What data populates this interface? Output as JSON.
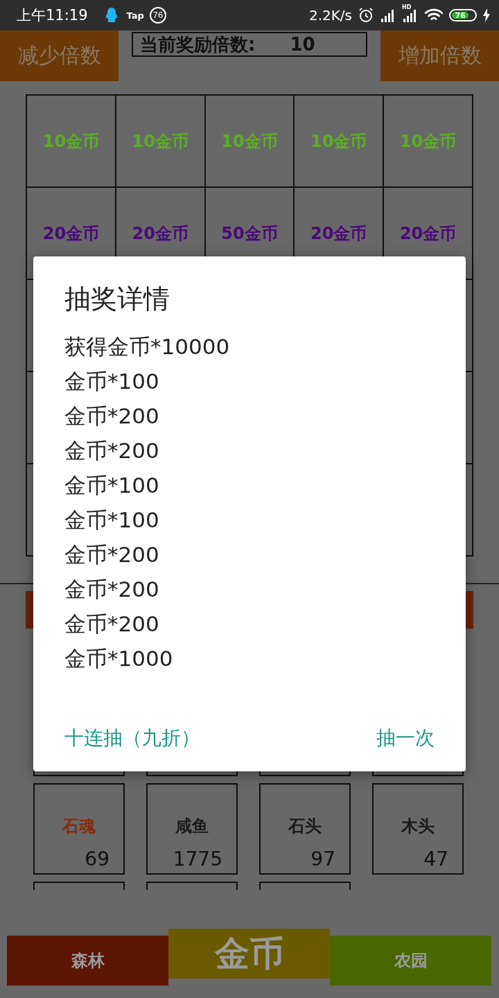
{
  "status_bar": {
    "time": "上午11:19",
    "app_label": "Tap",
    "notification_count": "76",
    "net_speed": "2.2K/s",
    "signal_tag": "HD",
    "battery": "76"
  },
  "header": {
    "decrease_button": "减少倍数",
    "multiplier_label": "当前奖励倍数:",
    "multiplier_value": "10",
    "increase_button": "增加倍数"
  },
  "prize_grid": {
    "rows": [
      {
        "cells": [
          {
            "label": "10金币",
            "color": "#5aae22"
          },
          {
            "label": "10金币",
            "color": "#5aae22"
          },
          {
            "label": "10金币",
            "color": "#5aae22"
          },
          {
            "label": "10金币",
            "color": "#5aae22"
          },
          {
            "label": "10金币",
            "color": "#5aae22"
          }
        ]
      },
      {
        "cells": [
          {
            "label": "20金币",
            "color": "#4a0a78"
          },
          {
            "label": "20金币",
            "color": "#4a0a78"
          },
          {
            "label": "50金币",
            "color": "#4a0a78"
          },
          {
            "label": "20金币",
            "color": "#4a0a78"
          },
          {
            "label": "20金币",
            "color": "#4a0a78"
          }
        ]
      }
    ]
  },
  "inventory": [
    {
      "name": "石魂",
      "count": "69",
      "color": "#8a2a0a"
    },
    {
      "name": "咸鱼",
      "count": "1775",
      "color": "#1a1a1a"
    },
    {
      "name": "石头",
      "count": "97",
      "color": "#1a1a1a"
    },
    {
      "name": "木头",
      "count": "47",
      "color": "#1a1a1a"
    }
  ],
  "bottom_tabs": [
    {
      "label": "森林",
      "selected": false,
      "color": "#5c1500"
    },
    {
      "label": "金币",
      "selected": true,
      "color": "#6b5a00"
    },
    {
      "label": "农园",
      "selected": false,
      "color": "#4a6600"
    }
  ],
  "dialog": {
    "title": "抽奖详情",
    "lines": [
      "获得金币*10000",
      "金币*100",
      "金币*200",
      "金币*200",
      "金币*100",
      "金币*100",
      "金币*200",
      "金币*200",
      "金币*200",
      "金币*1000"
    ],
    "buttons": [
      "十连抽（九折）",
      "抽一次"
    ]
  }
}
